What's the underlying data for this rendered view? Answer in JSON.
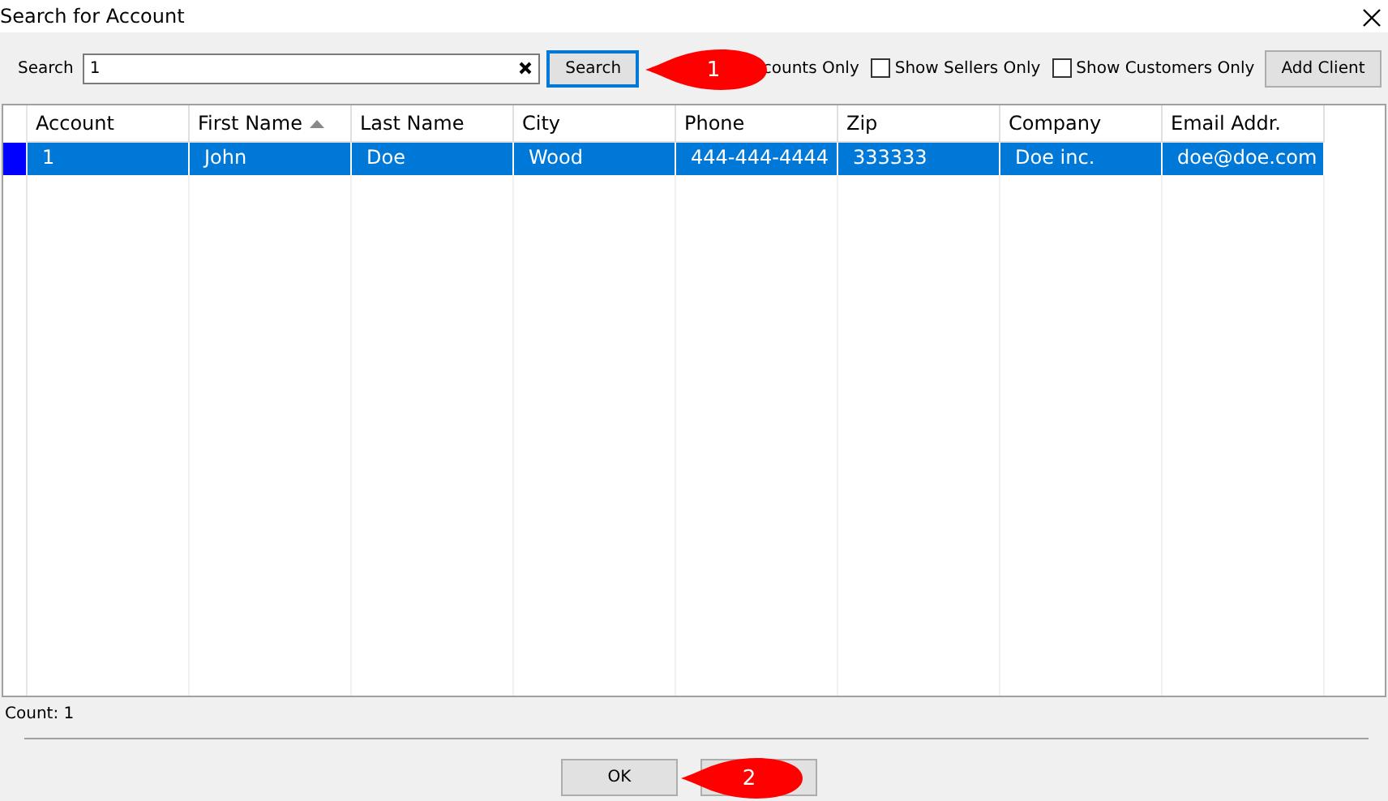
{
  "window": {
    "title": "Search for Account"
  },
  "search": {
    "label": "Search",
    "value": "1"
  },
  "search_button": "Search",
  "filters": [
    {
      "label": "counts Only"
    },
    {
      "label": "Show Sellers Only",
      "checked": false
    },
    {
      "label": "Show Customers Only",
      "checked": false
    }
  ],
  "add_button": "Add Client",
  "table": {
    "columns": [
      {
        "label": "Account",
        "sorted": false
      },
      {
        "label": "First Name",
        "sorted": true
      },
      {
        "label": "Last Name",
        "sorted": false
      },
      {
        "label": "City",
        "sorted": false
      },
      {
        "label": "Phone",
        "sorted": false
      },
      {
        "label": "Zip",
        "sorted": false
      },
      {
        "label": "Company",
        "sorted": false
      },
      {
        "label": "Email Addr.",
        "sorted": false
      }
    ],
    "rows": [
      {
        "selected": true,
        "cells": [
          "1",
          "John",
          "Doe",
          "Wood",
          "444-444-4444",
          "333333",
          "Doe inc.",
          "doe@doe.com"
        ]
      }
    ]
  },
  "count": "Count: 1",
  "buttons": [
    "OK"
  ],
  "callouts": [
    {
      "number": "1"
    },
    {
      "number": "2"
    }
  ]
}
